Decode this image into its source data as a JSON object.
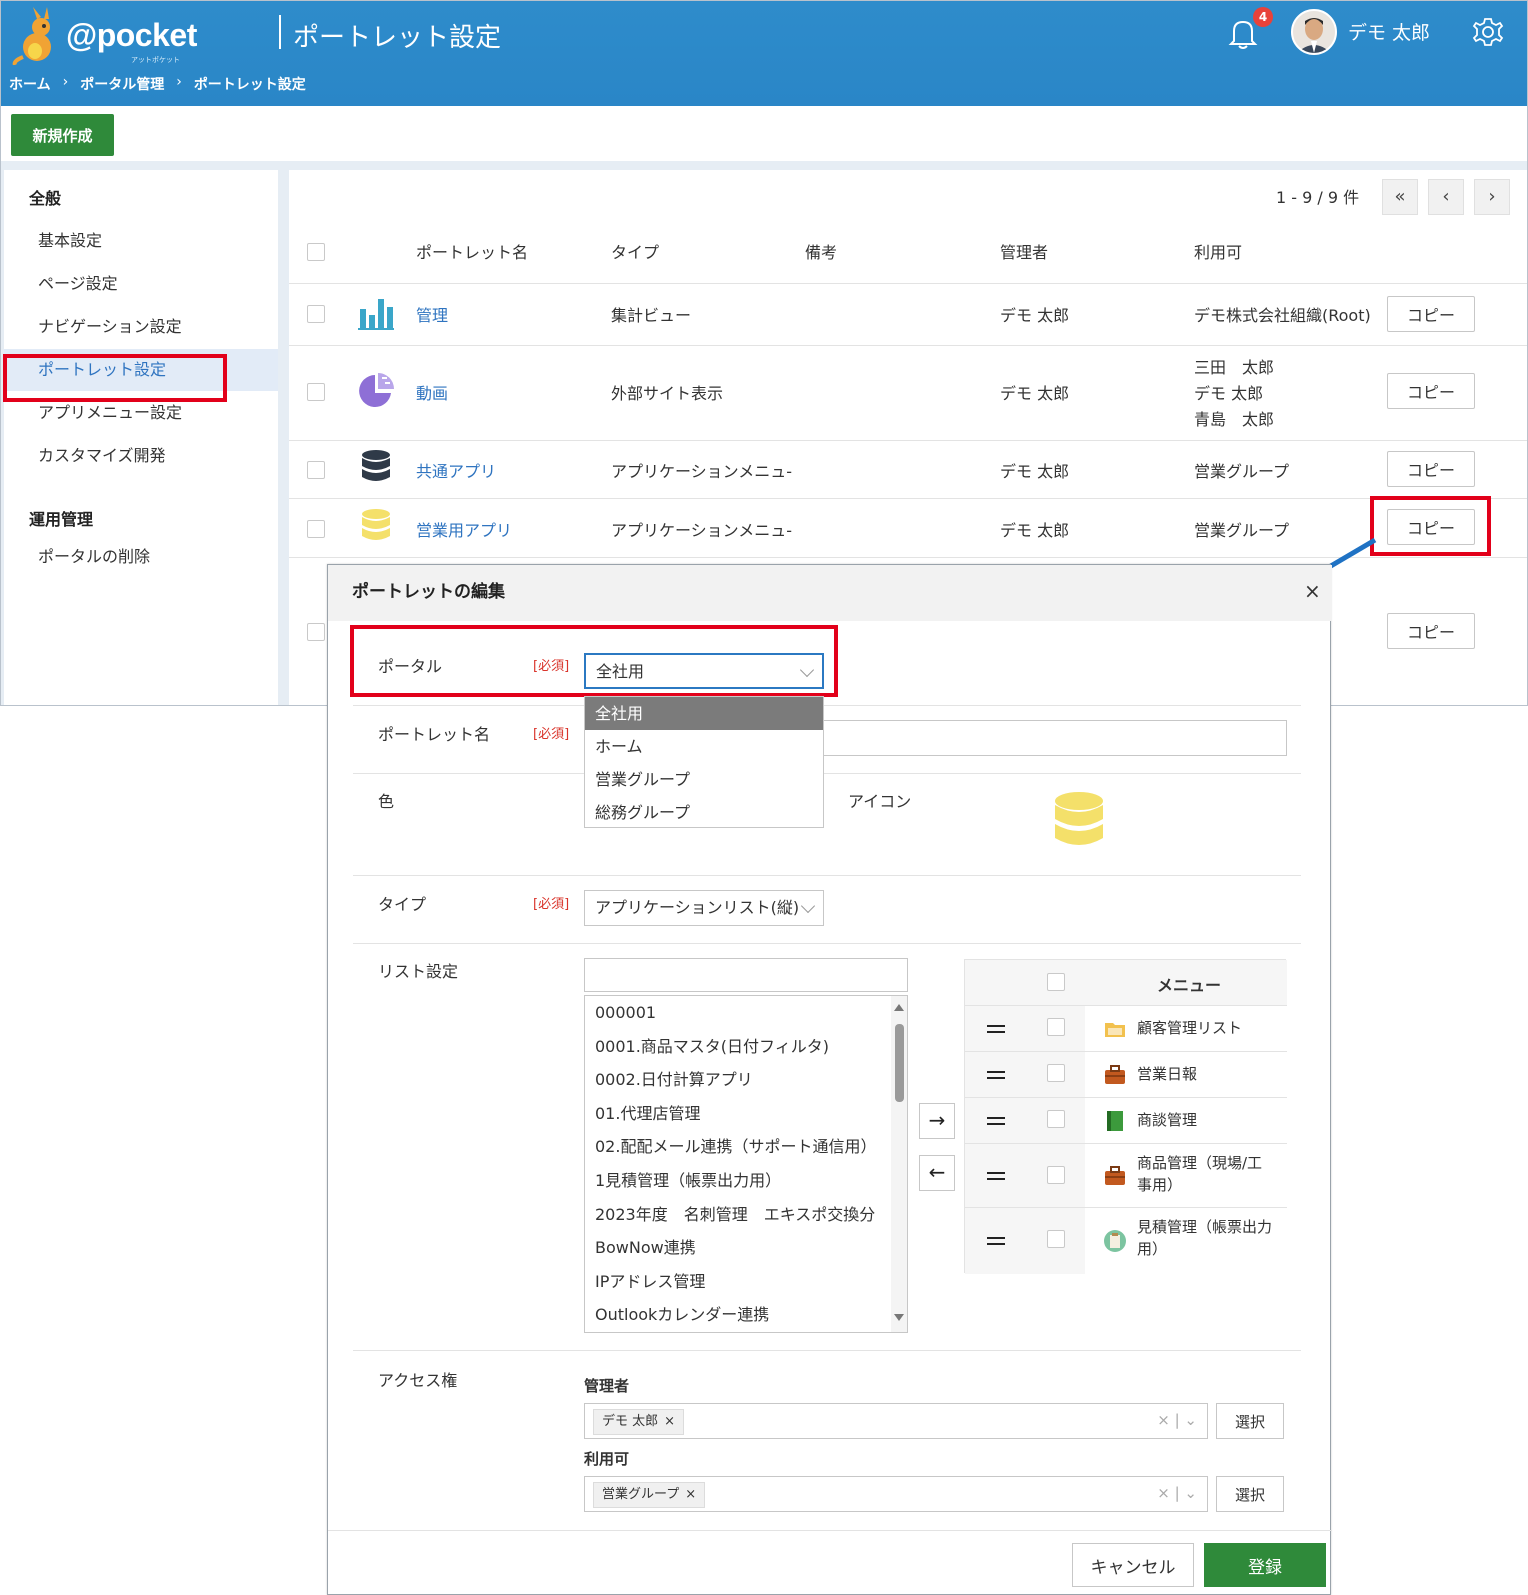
{
  "header": {
    "logo_text": "@pocket",
    "logo_sub": "アットポケット",
    "page_title": "ポートレット設定",
    "breadcrumb": [
      "ホーム",
      "ポータル管理",
      "ポートレット設定"
    ],
    "breadcrumb_sep": "›",
    "notification_count": "4",
    "user_name": "デモ 太郎"
  },
  "toolbar": {
    "new_label": "新規作成"
  },
  "sidebar": {
    "general_heading": "全般",
    "general_items": [
      "基本設定",
      "ページ設定",
      "ナビゲーション設定",
      "ポートレット設定",
      "アプリメニュー設定",
      "カスタマイズ開発"
    ],
    "active_index": 3,
    "ops_heading": "運用管理",
    "ops_items": [
      "ポータルの削除"
    ]
  },
  "table": {
    "pager_info": "1 - 9 / 9 件",
    "pager_first": "«",
    "pager_prev": "‹",
    "pager_next": "›",
    "headers": {
      "name": "ポートレット名",
      "type": "タイプ",
      "note": "備考",
      "admin": "管理者",
      "usable": "利用可"
    },
    "copy_label": "コピー",
    "rows": [
      {
        "icon": "bar-chart-icon",
        "name": "管理",
        "type": "集計ビュー",
        "note": "",
        "admin": "デモ 太郎",
        "usable": [
          "デモ株式会社組織(Root)"
        ]
      },
      {
        "icon": "pie-chart-icon",
        "name": "動画",
        "type": "外部サイト表示",
        "note": "",
        "admin": "デモ 太郎",
        "usable": [
          "三田　太郎",
          "デモ 太郎",
          "青島　太郎"
        ]
      },
      {
        "icon": "database-icon",
        "name": "共通アプリ",
        "type": "アプリケーションメニュ-",
        "note": "",
        "admin": "デモ 太郎",
        "usable": [
          "営業グループ"
        ]
      },
      {
        "icon": "database-icon",
        "name": "営業用アプリ",
        "type": "アプリケーションメニュ-",
        "note": "",
        "admin": "デモ 太郎",
        "usable": [
          "営業グループ"
        ]
      }
    ]
  },
  "modal": {
    "title": "ポートレットの編集",
    "close": "×",
    "required": "[必須]",
    "portal_label": "ポータル",
    "portal_value": "全社用",
    "portal_options": [
      "全社用",
      "ホーム",
      "営業グループ",
      "総務グループ"
    ],
    "portlet_name_label": "ポートレット名",
    "color_label": "色",
    "icon_label": "アイコン",
    "type_label": "タイプ",
    "type_value": "アプリケーションリスト(縦)",
    "list_label": "リスト設定",
    "list_items": [
      "000001",
      "0001.商品マスタ(日付フィルタ)",
      "0002.日付計算アプリ",
      "01.代理店管理",
      "02.配配メール連携（サポート通信用）",
      "1見積管理（帳票出力用）",
      "2023年度　名刺管理　エキスポ交換分",
      "BowNow連携",
      "IPアドレス管理",
      "Outlookカレンダー連携"
    ],
    "move_right": "→",
    "move_left": "←",
    "menu_header": "メニュー",
    "menu_items": [
      {
        "icon": "folder-icon",
        "label": "顧客管理リスト"
      },
      {
        "icon": "briefcase-icon",
        "label": "営業日報"
      },
      {
        "icon": "book-icon",
        "label": "商談管理"
      },
      {
        "icon": "briefcase-icon",
        "label": "商品管理（現場/工事用）"
      },
      {
        "icon": "clipboard-icon",
        "label": "見積管理（帳票出力用）"
      }
    ],
    "access_label": "アクセス権",
    "admin_label": "管理者",
    "admin_tag": "デモ 太郎",
    "usable_label": "利用可",
    "usable_tag": "営業グループ",
    "tag_remove": "×",
    "tag_clear": "×",
    "pick_label": "選択",
    "cancel_label": "キャンセル",
    "register_label": "登録"
  },
  "colors": {
    "header_blue": "#2a86c7",
    "primary_green": "#2f8a3a",
    "link_blue": "#2f74c0",
    "highlight_red": "#e2001a"
  }
}
